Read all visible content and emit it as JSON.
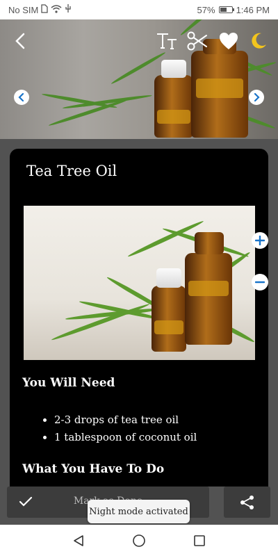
{
  "status_bar": {
    "carrier": "No SIM",
    "battery_percent": "57%",
    "battery_level": 0.57,
    "time": "1:46 PM"
  },
  "header": {
    "icons": [
      "back-arrow-icon",
      "text-size-icon",
      "scissors-icon",
      "heart-icon",
      "moon-icon",
      "chevron-left-icon",
      "chevron-right-icon"
    ]
  },
  "article": {
    "title": "Tea Tree Oil",
    "you_will_need_heading": "You Will Need",
    "ingredients": [
      "2-3 drops of tea tree oil",
      "1 tablespoon of coconut oil"
    ],
    "what_to_do_heading": "What You Have To Do"
  },
  "bottom_bar": {
    "label": "Mark as Done"
  },
  "toast": {
    "message": "Night mode activated"
  },
  "colors": {
    "card_background": "#000000",
    "accent_blue": "#1a74c9",
    "moon_yellow": "#f3c51d",
    "page_background": "#525252"
  }
}
